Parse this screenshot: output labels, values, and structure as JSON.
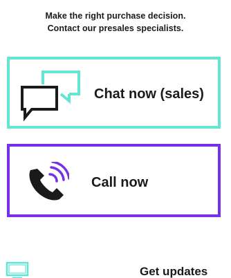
{
  "headline": {
    "line1": "Make the right purchase decision.",
    "line2": "Contact our presales specialists."
  },
  "chat": {
    "label": "Chat now (sales)",
    "icon": "chat-bubbles-icon",
    "border_color": "#62e5d3"
  },
  "call": {
    "label": "Call now",
    "icon": "phone-ringing-icon",
    "border_color": "#7630ea"
  },
  "updates": {
    "label": "Get updates",
    "icon": "monitor-icon"
  },
  "colors": {
    "text": "#1a1a1a",
    "teal": "#62e5d3",
    "purple": "#7630ea"
  }
}
